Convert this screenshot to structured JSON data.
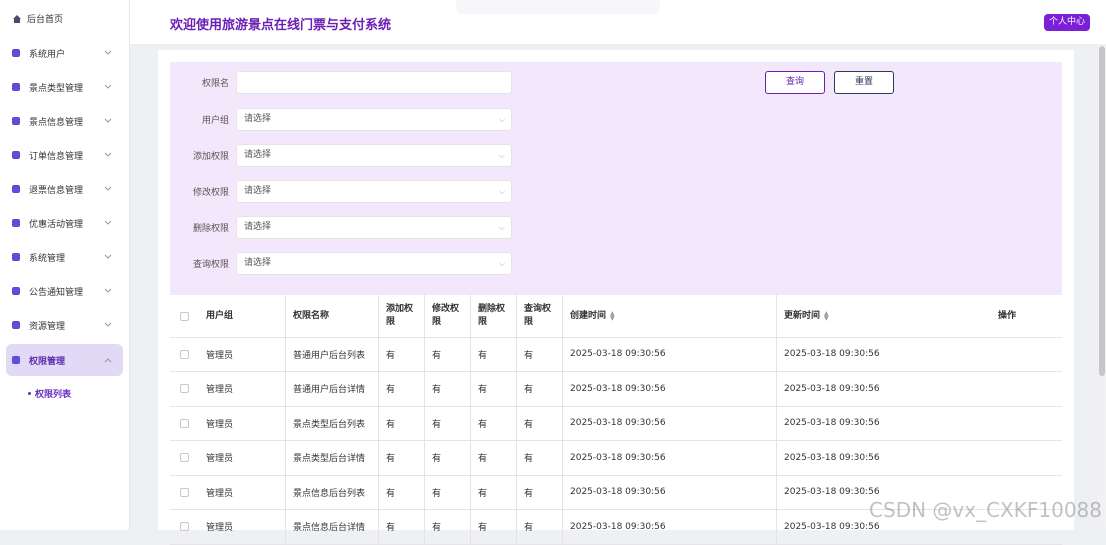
{
  "sidebar": {
    "home_label": "后台首页",
    "items": [
      {
        "label": "系统用户",
        "icon": "user-icon"
      },
      {
        "label": "景点类型管理",
        "icon": "tag-icon"
      },
      {
        "label": "景点信息管理",
        "icon": "doc-icon"
      },
      {
        "label": "订单信息管理",
        "icon": "order-icon"
      },
      {
        "label": "退票信息管理",
        "icon": "refund-icon"
      },
      {
        "label": "优惠活动管理",
        "icon": "discount-icon"
      },
      {
        "label": "系统管理",
        "icon": "settings-icon"
      },
      {
        "label": "公告通知管理",
        "icon": "notice-icon"
      },
      {
        "label": "资源管理",
        "icon": "resource-icon"
      },
      {
        "label": "权限管理",
        "icon": "permission-icon"
      }
    ],
    "sub_item": "权限列表"
  },
  "header": {
    "title": "欢迎使用旅游景点在线门票与支付系统",
    "user_center": "个人中心"
  },
  "search": {
    "fields": [
      {
        "label": "权限名",
        "value": ""
      },
      {
        "label": "用户组",
        "value": "请选择"
      },
      {
        "label": "添加权限",
        "value": "请选择"
      },
      {
        "label": "修改权限",
        "value": "请选择"
      },
      {
        "label": "删除权限",
        "value": "请选择"
      },
      {
        "label": "查询权限",
        "value": "请选择"
      }
    ],
    "query_btn": "查询",
    "reset_btn": "重置"
  },
  "table": {
    "headers": [
      "用户组",
      "权限名称",
      "添加权限",
      "修改权限",
      "删除权限",
      "查询权限",
      "创建时间",
      "更新时间",
      "操作"
    ],
    "header_lines": {
      "add": [
        "添加权",
        "限"
      ],
      "edit": [
        "修改权",
        "限"
      ],
      "del": [
        "删除权",
        "限"
      ],
      "query": [
        "查询权",
        "限"
      ]
    },
    "rows": [
      [
        "管理员",
        "普通用户后台列表",
        "有",
        "有",
        "有",
        "有",
        "2025-03-18 09:30:56",
        "2025-03-18 09:30:56"
      ],
      [
        "管理员",
        "普通用户后台详情",
        "有",
        "有",
        "有",
        "有",
        "2025-03-18 09:30:56",
        "2025-03-18 09:30:56"
      ],
      [
        "管理员",
        "景点类型后台列表",
        "有",
        "有",
        "有",
        "有",
        "2025-03-18 09:30:56",
        "2025-03-18 09:30:56"
      ],
      [
        "管理员",
        "景点类型后台详情",
        "有",
        "有",
        "有",
        "有",
        "2025-03-18 09:30:56",
        "2025-03-18 09:30:56"
      ],
      [
        "管理员",
        "景点信息后台列表",
        "有",
        "有",
        "有",
        "有",
        "2025-03-18 09:30:56",
        "2025-03-18 09:30:56"
      ],
      [
        "管理员",
        "景点信息后台详情",
        "有",
        "有",
        "有",
        "有",
        "2025-03-18 09:30:56",
        "2025-03-18 09:30:56"
      ]
    ]
  },
  "watermark": "CSDN @vx_CXKF10088",
  "colors": {
    "accent": "#6a1fb5",
    "panel": "#f3e8fb",
    "active_bg": "#e2d9f7"
  }
}
